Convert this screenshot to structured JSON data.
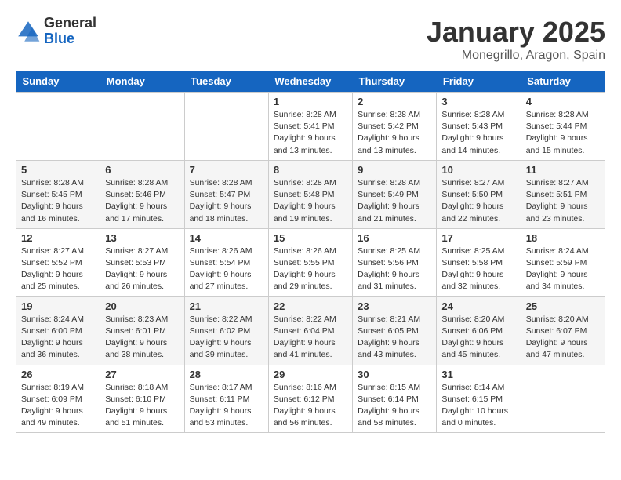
{
  "header": {
    "logo": {
      "general": "General",
      "blue": "Blue"
    },
    "title": "January 2025",
    "subtitle": "Monegrillo, Aragon, Spain"
  },
  "days_of_week": [
    "Sunday",
    "Monday",
    "Tuesday",
    "Wednesday",
    "Thursday",
    "Friday",
    "Saturday"
  ],
  "weeks": [
    [
      {
        "day": "",
        "info": ""
      },
      {
        "day": "",
        "info": ""
      },
      {
        "day": "",
        "info": ""
      },
      {
        "day": "1",
        "info": "Sunrise: 8:28 AM\nSunset: 5:41 PM\nDaylight: 9 hours\nand 13 minutes."
      },
      {
        "day": "2",
        "info": "Sunrise: 8:28 AM\nSunset: 5:42 PM\nDaylight: 9 hours\nand 13 minutes."
      },
      {
        "day": "3",
        "info": "Sunrise: 8:28 AM\nSunset: 5:43 PM\nDaylight: 9 hours\nand 14 minutes."
      },
      {
        "day": "4",
        "info": "Sunrise: 8:28 AM\nSunset: 5:44 PM\nDaylight: 9 hours\nand 15 minutes."
      }
    ],
    [
      {
        "day": "5",
        "info": "Sunrise: 8:28 AM\nSunset: 5:45 PM\nDaylight: 9 hours\nand 16 minutes."
      },
      {
        "day": "6",
        "info": "Sunrise: 8:28 AM\nSunset: 5:46 PM\nDaylight: 9 hours\nand 17 minutes."
      },
      {
        "day": "7",
        "info": "Sunrise: 8:28 AM\nSunset: 5:47 PM\nDaylight: 9 hours\nand 18 minutes."
      },
      {
        "day": "8",
        "info": "Sunrise: 8:28 AM\nSunset: 5:48 PM\nDaylight: 9 hours\nand 19 minutes."
      },
      {
        "day": "9",
        "info": "Sunrise: 8:28 AM\nSunset: 5:49 PM\nDaylight: 9 hours\nand 21 minutes."
      },
      {
        "day": "10",
        "info": "Sunrise: 8:27 AM\nSunset: 5:50 PM\nDaylight: 9 hours\nand 22 minutes."
      },
      {
        "day": "11",
        "info": "Sunrise: 8:27 AM\nSunset: 5:51 PM\nDaylight: 9 hours\nand 23 minutes."
      }
    ],
    [
      {
        "day": "12",
        "info": "Sunrise: 8:27 AM\nSunset: 5:52 PM\nDaylight: 9 hours\nand 25 minutes."
      },
      {
        "day": "13",
        "info": "Sunrise: 8:27 AM\nSunset: 5:53 PM\nDaylight: 9 hours\nand 26 minutes."
      },
      {
        "day": "14",
        "info": "Sunrise: 8:26 AM\nSunset: 5:54 PM\nDaylight: 9 hours\nand 27 minutes."
      },
      {
        "day": "15",
        "info": "Sunrise: 8:26 AM\nSunset: 5:55 PM\nDaylight: 9 hours\nand 29 minutes."
      },
      {
        "day": "16",
        "info": "Sunrise: 8:25 AM\nSunset: 5:56 PM\nDaylight: 9 hours\nand 31 minutes."
      },
      {
        "day": "17",
        "info": "Sunrise: 8:25 AM\nSunset: 5:58 PM\nDaylight: 9 hours\nand 32 minutes."
      },
      {
        "day": "18",
        "info": "Sunrise: 8:24 AM\nSunset: 5:59 PM\nDaylight: 9 hours\nand 34 minutes."
      }
    ],
    [
      {
        "day": "19",
        "info": "Sunrise: 8:24 AM\nSunset: 6:00 PM\nDaylight: 9 hours\nand 36 minutes."
      },
      {
        "day": "20",
        "info": "Sunrise: 8:23 AM\nSunset: 6:01 PM\nDaylight: 9 hours\nand 38 minutes."
      },
      {
        "day": "21",
        "info": "Sunrise: 8:22 AM\nSunset: 6:02 PM\nDaylight: 9 hours\nand 39 minutes."
      },
      {
        "day": "22",
        "info": "Sunrise: 8:22 AM\nSunset: 6:04 PM\nDaylight: 9 hours\nand 41 minutes."
      },
      {
        "day": "23",
        "info": "Sunrise: 8:21 AM\nSunset: 6:05 PM\nDaylight: 9 hours\nand 43 minutes."
      },
      {
        "day": "24",
        "info": "Sunrise: 8:20 AM\nSunset: 6:06 PM\nDaylight: 9 hours\nand 45 minutes."
      },
      {
        "day": "25",
        "info": "Sunrise: 8:20 AM\nSunset: 6:07 PM\nDaylight: 9 hours\nand 47 minutes."
      }
    ],
    [
      {
        "day": "26",
        "info": "Sunrise: 8:19 AM\nSunset: 6:09 PM\nDaylight: 9 hours\nand 49 minutes."
      },
      {
        "day": "27",
        "info": "Sunrise: 8:18 AM\nSunset: 6:10 PM\nDaylight: 9 hours\nand 51 minutes."
      },
      {
        "day": "28",
        "info": "Sunrise: 8:17 AM\nSunset: 6:11 PM\nDaylight: 9 hours\nand 53 minutes."
      },
      {
        "day": "29",
        "info": "Sunrise: 8:16 AM\nSunset: 6:12 PM\nDaylight: 9 hours\nand 56 minutes."
      },
      {
        "day": "30",
        "info": "Sunrise: 8:15 AM\nSunset: 6:14 PM\nDaylight: 9 hours\nand 58 minutes."
      },
      {
        "day": "31",
        "info": "Sunrise: 8:14 AM\nSunset: 6:15 PM\nDaylight: 10 hours\nand 0 minutes."
      },
      {
        "day": "",
        "info": ""
      }
    ]
  ]
}
